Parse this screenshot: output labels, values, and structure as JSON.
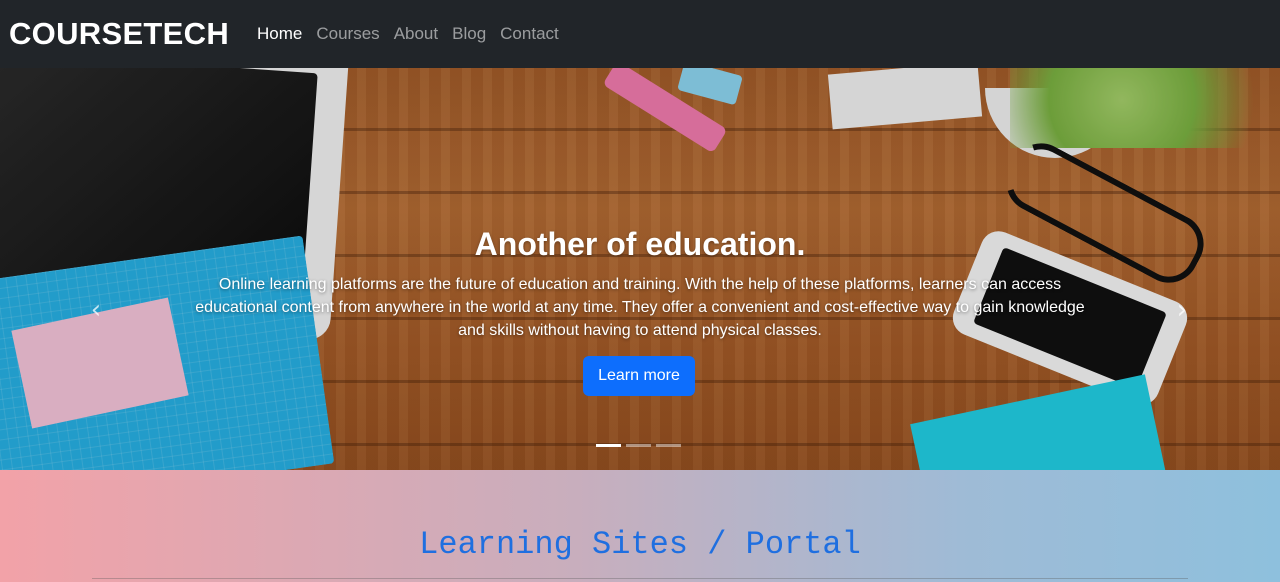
{
  "navbar": {
    "brand": "COURSETECH",
    "links": [
      {
        "label": "Home",
        "active": true
      },
      {
        "label": "Courses",
        "active": false
      },
      {
        "label": "About",
        "active": false
      },
      {
        "label": "Blog",
        "active": false
      },
      {
        "label": "Contact",
        "active": false
      }
    ]
  },
  "carousel": {
    "title": "Another of education.",
    "text": "Online learning platforms are the future of education and training. With the help of these platforms, learners can access educational content from anywhere in the world at any time. They offer a convenient and cost-effective way to gain knowledge and skills without having to attend physical classes.",
    "button_label": "Learn more",
    "prev_icon": "chevron-left-icon",
    "next_icon": "chevron-right-icon",
    "slide_count": 3,
    "active_slide": 1
  },
  "section": {
    "heading": "Learning Sites / Portal"
  },
  "colors": {
    "navbar_bg": "#212529",
    "primary": "#0d6efd",
    "heading_blue": "#1f6fe0"
  }
}
